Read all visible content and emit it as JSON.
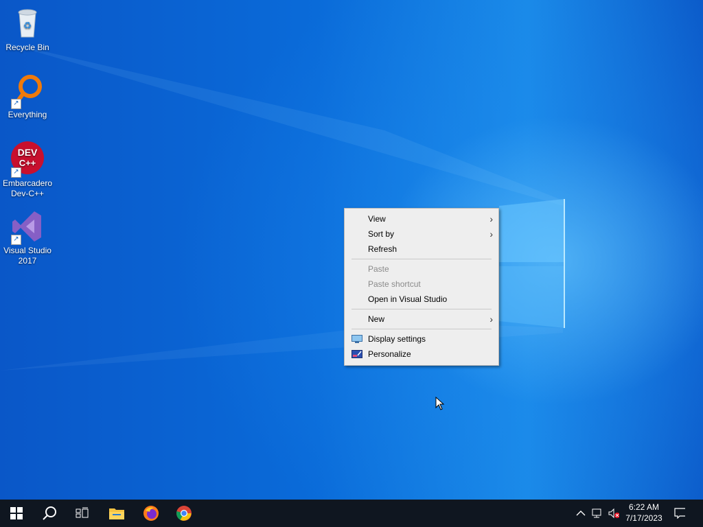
{
  "desktop_icons": [
    {
      "id": "recycle_bin",
      "label": "Recycle Bin",
      "icon": "recycle-bin-icon"
    },
    {
      "id": "everything",
      "label": "Everything",
      "icon": "magnifier-icon"
    },
    {
      "id": "devcpp",
      "label_line1": "Embarcadero",
      "label_line2": "Dev-C++",
      "icon_text_line1": "DEV",
      "icon_text_line2": "C++",
      "icon": "devcpp-icon"
    },
    {
      "id": "vs2017",
      "label_line1": "Visual Studio",
      "label_line2": "2017",
      "icon": "visual-studio-icon"
    }
  ],
  "context_menu": {
    "items": [
      {
        "label": "View",
        "submenu": true,
        "disabled": false
      },
      {
        "label": "Sort by",
        "submenu": true,
        "disabled": false
      },
      {
        "label": "Refresh",
        "submenu": false,
        "disabled": false
      },
      {
        "label": "Paste",
        "submenu": false,
        "disabled": true
      },
      {
        "label": "Paste shortcut",
        "submenu": false,
        "disabled": true
      },
      {
        "label": "Open in Visual Studio",
        "submenu": false,
        "disabled": false
      },
      {
        "label": "New",
        "submenu": true,
        "disabled": false
      },
      {
        "label": "Display settings",
        "icon": "display-settings-icon",
        "disabled": false
      },
      {
        "label": "Personalize",
        "icon": "personalize-icon",
        "disabled": false
      }
    ],
    "submenu_arrow": "›"
  },
  "taskbar": {
    "apps": [
      "start-icon",
      "search-icon",
      "task-view-icon",
      "file-explorer-icon",
      "firefox-icon",
      "chrome-icon"
    ],
    "clock": {
      "time": "6:22 AM",
      "date": "7/17/2023"
    }
  },
  "colors": {
    "accent": "#0a63d8",
    "taskbar": "#0f1620",
    "menu_bg": "#eeeeee"
  }
}
